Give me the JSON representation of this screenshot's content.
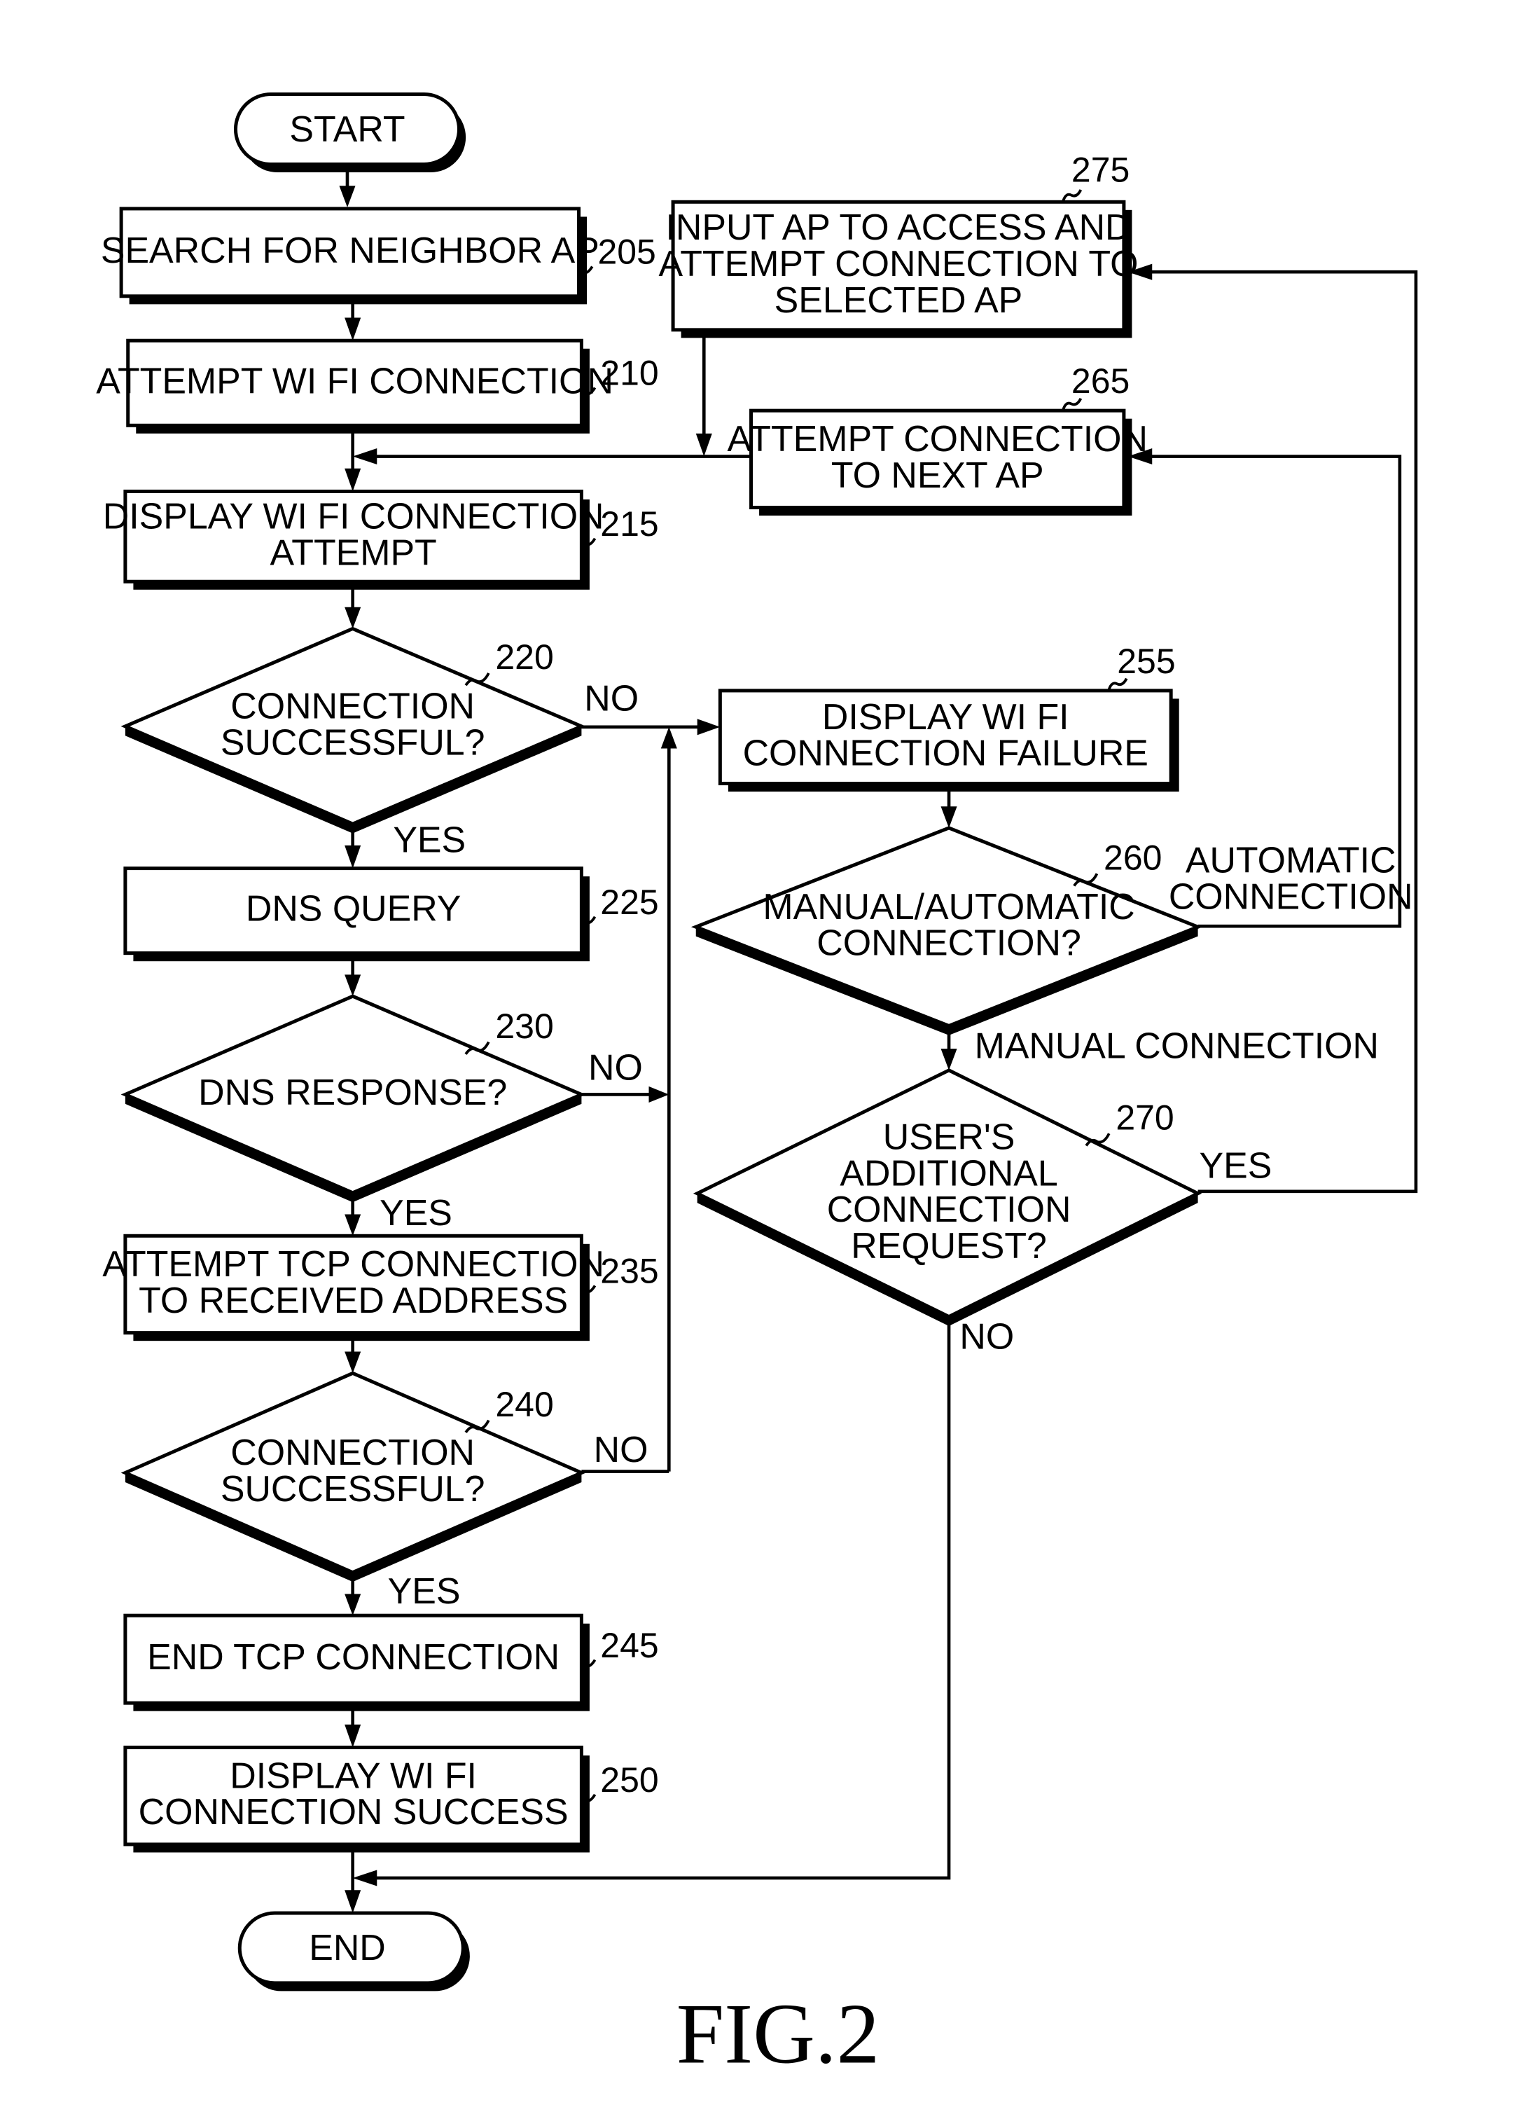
{
  "figure": {
    "caption": "FIG.2"
  },
  "nodes": {
    "start": {
      "label": "START"
    },
    "end": {
      "label": "END"
    },
    "n205": {
      "ref": "205",
      "lines": [
        "SEARCH FOR NEIGHBOR AP"
      ]
    },
    "n210": {
      "ref": "210",
      "lines": [
        "ATTEMPT WI FI CONNECTION"
      ]
    },
    "n215": {
      "ref": "215",
      "lines": [
        "DISPLAY WI FI CONNECTION",
        "ATTEMPT"
      ]
    },
    "n220": {
      "ref": "220",
      "lines": [
        "CONNECTION",
        "SUCCESSFUL?"
      ]
    },
    "n225": {
      "ref": "225",
      "lines": [
        "DNS QUERY"
      ]
    },
    "n230": {
      "ref": "230",
      "lines": [
        "DNS RESPONSE?"
      ]
    },
    "n235": {
      "ref": "235",
      "lines": [
        "ATTEMPT TCP CONNECTION",
        "TO RECEIVED ADDRESS"
      ]
    },
    "n240": {
      "ref": "240",
      "lines": [
        "CONNECTION",
        "SUCCESSFUL?"
      ]
    },
    "n245": {
      "ref": "245",
      "lines": [
        "END TCP CONNECTION"
      ]
    },
    "n250": {
      "ref": "250",
      "lines": [
        "DISPLAY WI FI",
        "CONNECTION SUCCESS"
      ]
    },
    "n255": {
      "ref": "255",
      "lines": [
        "DISPLAY WI FI",
        "CONNECTION FAILURE"
      ]
    },
    "n260": {
      "ref": "260",
      "lines": [
        "MANUAL/AUTOMATIC",
        "CONNECTION?"
      ]
    },
    "n265": {
      "ref": "265",
      "lines": [
        "ATTEMPT CONNECTION",
        "TO NEXT AP"
      ]
    },
    "n270": {
      "ref": "270",
      "lines": [
        "USER'S",
        "ADDITIONAL",
        "CONNECTION",
        "REQUEST?"
      ]
    },
    "n275": {
      "ref": "275",
      "lines": [
        "INPUT AP TO ACCESS AND",
        "ATTEMPT CONNECTION TO",
        "SELECTED AP"
      ]
    }
  },
  "edge_labels": {
    "e220_yes": "YES",
    "e220_no": "NO",
    "e230_yes": "YES",
    "e230_no": "NO",
    "e240_yes": "YES",
    "e240_no": "NO",
    "e260_auto": [
      "AUTOMATIC",
      "CONNECTION"
    ],
    "e260_manual": "MANUAL CONNECTION",
    "e270_yes": "YES",
    "e270_no": "NO"
  }
}
